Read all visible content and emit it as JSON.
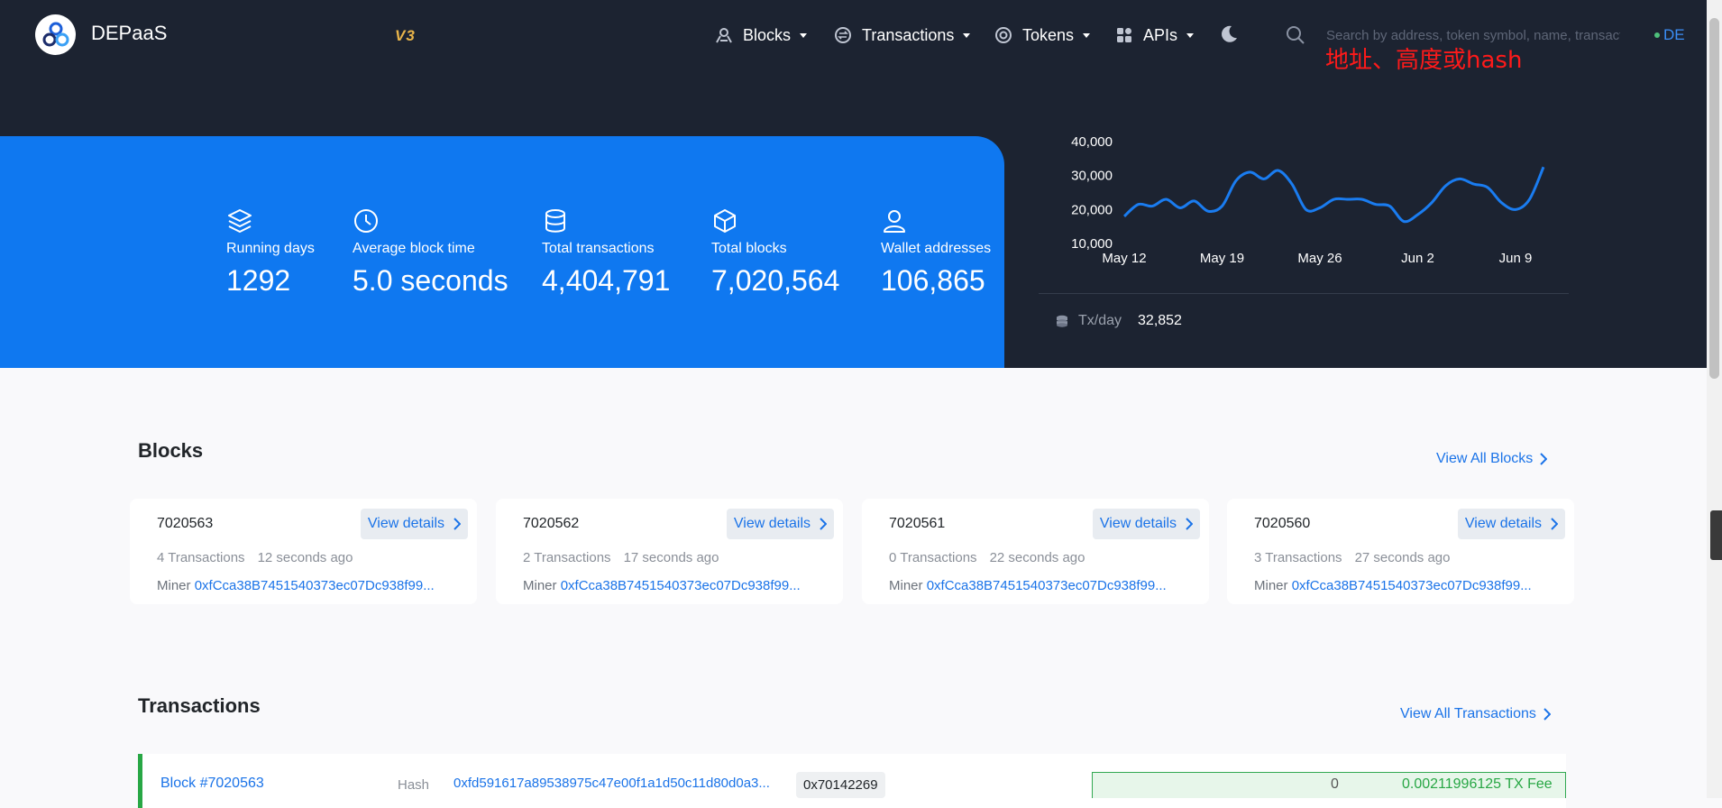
{
  "header": {
    "brand": "DEPaaS",
    "version": "V3",
    "nav": [
      {
        "label": "Blocks",
        "icon": "blocks-icon"
      },
      {
        "label": "Transactions",
        "icon": "transactions-icon"
      },
      {
        "label": "Tokens",
        "icon": "tokens-icon"
      },
      {
        "label": "APIs",
        "icon": "apis-icon"
      }
    ],
    "search_placeholder": "Search by address, token symbol, name, transaction hash, or block number",
    "language": "DE",
    "annotation": "地址、高度或hash"
  },
  "stats": [
    {
      "label": "Running days",
      "value": "1292",
      "icon": "layers-icon"
    },
    {
      "label": "Average block time",
      "value": "5.0 seconds",
      "icon": "clock-icon"
    },
    {
      "label": "Total transactions",
      "value": "4,404,791",
      "icon": "database-icon"
    },
    {
      "label": "Total blocks",
      "value": "7,020,564",
      "icon": "cube-icon"
    },
    {
      "label": "Wallet addresses",
      "value": "106,865",
      "icon": "user-icon"
    }
  ],
  "chart_data": {
    "type": "line",
    "title": "",
    "xlabel": "",
    "ylabel": "",
    "x_ticks": [
      "May 12",
      "May 19",
      "May 26",
      "Jun 2",
      "Jun 9"
    ],
    "y_ticks": [
      "10,000",
      "20,000",
      "30,000",
      "40,000"
    ],
    "ylim": [
      10000,
      40000
    ],
    "grid": false,
    "series": [
      {
        "color": "#1a7cf0",
        "x": [
          "May 12",
          "May 13",
          "May 14",
          "May 15",
          "May 16",
          "May 17",
          "May 18",
          "May 19",
          "May 20",
          "May 21",
          "May 22",
          "May 23",
          "May 24",
          "May 25",
          "May 26",
          "May 27",
          "May 28",
          "May 29",
          "May 30",
          "May 31",
          "Jun 1",
          "Jun 2",
          "Jun 3",
          "Jun 4",
          "Jun 5",
          "Jun 6",
          "Jun 7",
          "Jun 8",
          "Jun 9",
          "Jun 10",
          "Jun 11"
        ],
        "values": [
          18000,
          21500,
          21000,
          23000,
          20500,
          22500,
          19500,
          21000,
          28500,
          31000,
          29000,
          31500,
          27500,
          20000,
          20500,
          23000,
          23000,
          23000,
          21500,
          21000,
          16500,
          18500,
          22000,
          27000,
          29000,
          27500,
          26500,
          22000,
          20000,
          23000,
          32500
        ]
      }
    ],
    "stat_label": "Tx/day",
    "stat_value": "32,852"
  },
  "blocks_section": {
    "title": "Blocks",
    "view_all": "View All Blocks",
    "cards": [
      {
        "number": "7020563",
        "tx_count": "4 Transactions",
        "age": "12 seconds ago",
        "miner_label": "Miner",
        "miner": "0xfCca38B7451540373ec07Dc938f99...",
        "details": "View details"
      },
      {
        "number": "7020562",
        "tx_count": "2 Transactions",
        "age": "17 seconds ago",
        "miner_label": "Miner",
        "miner": "0xfCca38B7451540373ec07Dc938f99...",
        "details": "View details"
      },
      {
        "number": "7020561",
        "tx_count": "0 Transactions",
        "age": "22 seconds ago",
        "miner_label": "Miner",
        "miner": "0xfCca38B7451540373ec07Dc938f99...",
        "details": "View details"
      },
      {
        "number": "7020560",
        "tx_count": "3 Transactions",
        "age": "27 seconds ago",
        "miner_label": "Miner",
        "miner": "0xfCca38B7451540373ec07Dc938f99...",
        "details": "View details"
      }
    ]
  },
  "transactions_section": {
    "title": "Transactions",
    "view_all": "View All Transactions",
    "rows": [
      {
        "block": "Block #7020563",
        "hash_label": "Hash",
        "hash": "0xfd591617a89538975c47e00f1a1d50c11d80d0a3...",
        "method": "0x70142269",
        "value": "0",
        "fee": "0.00211996125 TX Fee"
      }
    ]
  },
  "colors": {
    "dark_bg": "#1c2331",
    "hero_blue": "#0f78f0",
    "link": "#1a73e8",
    "success": "#28a745",
    "version": "#e8b44a"
  }
}
